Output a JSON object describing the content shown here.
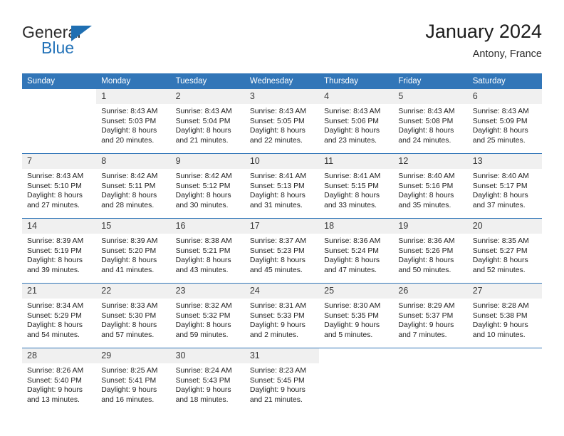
{
  "brand": {
    "name_dark": "General",
    "name_blue": "Blue",
    "accent_color": "#2272b8",
    "triangle_icon": "triangle-icon"
  },
  "header": {
    "title": "January 2024",
    "location": "Antony, France",
    "header_bg": "#3276b8",
    "daynum_bg": "#f0f0f0"
  },
  "weekday_headers": [
    "Sunday",
    "Monday",
    "Tuesday",
    "Wednesday",
    "Thursday",
    "Friday",
    "Saturday"
  ],
  "weeks": [
    [
      {
        "day": "",
        "sunrise": "",
        "sunset": "",
        "daylight_line1": "",
        "daylight_line2": "",
        "state": "blank"
      },
      {
        "day": "1",
        "sunrise": "Sunrise: 8:43 AM",
        "sunset": "Sunset: 5:03 PM",
        "daylight_line1": "Daylight: 8 hours",
        "daylight_line2": "and 20 minutes.",
        "state": "filled"
      },
      {
        "day": "2",
        "sunrise": "Sunrise: 8:43 AM",
        "sunset": "Sunset: 5:04 PM",
        "daylight_line1": "Daylight: 8 hours",
        "daylight_line2": "and 21 minutes.",
        "state": "filled"
      },
      {
        "day": "3",
        "sunrise": "Sunrise: 8:43 AM",
        "sunset": "Sunset: 5:05 PM",
        "daylight_line1": "Daylight: 8 hours",
        "daylight_line2": "and 22 minutes.",
        "state": "filled"
      },
      {
        "day": "4",
        "sunrise": "Sunrise: 8:43 AM",
        "sunset": "Sunset: 5:06 PM",
        "daylight_line1": "Daylight: 8 hours",
        "daylight_line2": "and 23 minutes.",
        "state": "filled"
      },
      {
        "day": "5",
        "sunrise": "Sunrise: 8:43 AM",
        "sunset": "Sunset: 5:08 PM",
        "daylight_line1": "Daylight: 8 hours",
        "daylight_line2": "and 24 minutes.",
        "state": "filled"
      },
      {
        "day": "6",
        "sunrise": "Sunrise: 8:43 AM",
        "sunset": "Sunset: 5:09 PM",
        "daylight_line1": "Daylight: 8 hours",
        "daylight_line2": "and 25 minutes.",
        "state": "filled"
      }
    ],
    [
      {
        "day": "7",
        "sunrise": "Sunrise: 8:43 AM",
        "sunset": "Sunset: 5:10 PM",
        "daylight_line1": "Daylight: 8 hours",
        "daylight_line2": "and 27 minutes.",
        "state": "filled"
      },
      {
        "day": "8",
        "sunrise": "Sunrise: 8:42 AM",
        "sunset": "Sunset: 5:11 PM",
        "daylight_line1": "Daylight: 8 hours",
        "daylight_line2": "and 28 minutes.",
        "state": "filled"
      },
      {
        "day": "9",
        "sunrise": "Sunrise: 8:42 AM",
        "sunset": "Sunset: 5:12 PM",
        "daylight_line1": "Daylight: 8 hours",
        "daylight_line2": "and 30 minutes.",
        "state": "filled"
      },
      {
        "day": "10",
        "sunrise": "Sunrise: 8:41 AM",
        "sunset": "Sunset: 5:13 PM",
        "daylight_line1": "Daylight: 8 hours",
        "daylight_line2": "and 31 minutes.",
        "state": "filled"
      },
      {
        "day": "11",
        "sunrise": "Sunrise: 8:41 AM",
        "sunset": "Sunset: 5:15 PM",
        "daylight_line1": "Daylight: 8 hours",
        "daylight_line2": "and 33 minutes.",
        "state": "filled"
      },
      {
        "day": "12",
        "sunrise": "Sunrise: 8:40 AM",
        "sunset": "Sunset: 5:16 PM",
        "daylight_line1": "Daylight: 8 hours",
        "daylight_line2": "and 35 minutes.",
        "state": "filled"
      },
      {
        "day": "13",
        "sunrise": "Sunrise: 8:40 AM",
        "sunset": "Sunset: 5:17 PM",
        "daylight_line1": "Daylight: 8 hours",
        "daylight_line2": "and 37 minutes.",
        "state": "filled"
      }
    ],
    [
      {
        "day": "14",
        "sunrise": "Sunrise: 8:39 AM",
        "sunset": "Sunset: 5:19 PM",
        "daylight_line1": "Daylight: 8 hours",
        "daylight_line2": "and 39 minutes.",
        "state": "filled"
      },
      {
        "day": "15",
        "sunrise": "Sunrise: 8:39 AM",
        "sunset": "Sunset: 5:20 PM",
        "daylight_line1": "Daylight: 8 hours",
        "daylight_line2": "and 41 minutes.",
        "state": "filled"
      },
      {
        "day": "16",
        "sunrise": "Sunrise: 8:38 AM",
        "sunset": "Sunset: 5:21 PM",
        "daylight_line1": "Daylight: 8 hours",
        "daylight_line2": "and 43 minutes.",
        "state": "filled"
      },
      {
        "day": "17",
        "sunrise": "Sunrise: 8:37 AM",
        "sunset": "Sunset: 5:23 PM",
        "daylight_line1": "Daylight: 8 hours",
        "daylight_line2": "and 45 minutes.",
        "state": "filled"
      },
      {
        "day": "18",
        "sunrise": "Sunrise: 8:36 AM",
        "sunset": "Sunset: 5:24 PM",
        "daylight_line1": "Daylight: 8 hours",
        "daylight_line2": "and 47 minutes.",
        "state": "filled"
      },
      {
        "day": "19",
        "sunrise": "Sunrise: 8:36 AM",
        "sunset": "Sunset: 5:26 PM",
        "daylight_line1": "Daylight: 8 hours",
        "daylight_line2": "and 50 minutes.",
        "state": "filled"
      },
      {
        "day": "20",
        "sunrise": "Sunrise: 8:35 AM",
        "sunset": "Sunset: 5:27 PM",
        "daylight_line1": "Daylight: 8 hours",
        "daylight_line2": "and 52 minutes.",
        "state": "filled"
      }
    ],
    [
      {
        "day": "21",
        "sunrise": "Sunrise: 8:34 AM",
        "sunset": "Sunset: 5:29 PM",
        "daylight_line1": "Daylight: 8 hours",
        "daylight_line2": "and 54 minutes.",
        "state": "filled"
      },
      {
        "day": "22",
        "sunrise": "Sunrise: 8:33 AM",
        "sunset": "Sunset: 5:30 PM",
        "daylight_line1": "Daylight: 8 hours",
        "daylight_line2": "and 57 minutes.",
        "state": "filled"
      },
      {
        "day": "23",
        "sunrise": "Sunrise: 8:32 AM",
        "sunset": "Sunset: 5:32 PM",
        "daylight_line1": "Daylight: 8 hours",
        "daylight_line2": "and 59 minutes.",
        "state": "filled"
      },
      {
        "day": "24",
        "sunrise": "Sunrise: 8:31 AM",
        "sunset": "Sunset: 5:33 PM",
        "daylight_line1": "Daylight: 9 hours",
        "daylight_line2": "and 2 minutes.",
        "state": "filled"
      },
      {
        "day": "25",
        "sunrise": "Sunrise: 8:30 AM",
        "sunset": "Sunset: 5:35 PM",
        "daylight_line1": "Daylight: 9 hours",
        "daylight_line2": "and 5 minutes.",
        "state": "filled"
      },
      {
        "day": "26",
        "sunrise": "Sunrise: 8:29 AM",
        "sunset": "Sunset: 5:37 PM",
        "daylight_line1": "Daylight: 9 hours",
        "daylight_line2": "and 7 minutes.",
        "state": "filled"
      },
      {
        "day": "27",
        "sunrise": "Sunrise: 8:28 AM",
        "sunset": "Sunset: 5:38 PM",
        "daylight_line1": "Daylight: 9 hours",
        "daylight_line2": "and 10 minutes.",
        "state": "filled"
      }
    ],
    [
      {
        "day": "28",
        "sunrise": "Sunrise: 8:26 AM",
        "sunset": "Sunset: 5:40 PM",
        "daylight_line1": "Daylight: 9 hours",
        "daylight_line2": "and 13 minutes.",
        "state": "filled"
      },
      {
        "day": "29",
        "sunrise": "Sunrise: 8:25 AM",
        "sunset": "Sunset: 5:41 PM",
        "daylight_line1": "Daylight: 9 hours",
        "daylight_line2": "and 16 minutes.",
        "state": "filled"
      },
      {
        "day": "30",
        "sunrise": "Sunrise: 8:24 AM",
        "sunset": "Sunset: 5:43 PM",
        "daylight_line1": "Daylight: 9 hours",
        "daylight_line2": "and 18 minutes.",
        "state": "filled"
      },
      {
        "day": "31",
        "sunrise": "Sunrise: 8:23 AM",
        "sunset": "Sunset: 5:45 PM",
        "daylight_line1": "Daylight: 9 hours",
        "daylight_line2": "and 21 minutes.",
        "state": "filled"
      },
      {
        "day": "",
        "sunrise": "",
        "sunset": "",
        "daylight_line1": "",
        "daylight_line2": "",
        "state": "blank"
      },
      {
        "day": "",
        "sunrise": "",
        "sunset": "",
        "daylight_line1": "",
        "daylight_line2": "",
        "state": "blank"
      },
      {
        "day": "",
        "sunrise": "",
        "sunset": "",
        "daylight_line1": "",
        "daylight_line2": "",
        "state": "blank"
      }
    ]
  ]
}
